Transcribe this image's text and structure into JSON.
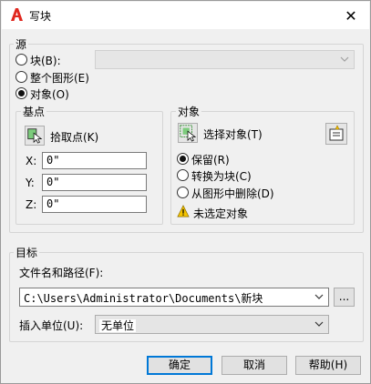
{
  "window": {
    "title": "写块",
    "close_glyph": "✕"
  },
  "source": {
    "legend": "源",
    "options": [
      {
        "label": "块(B):",
        "selected": false
      },
      {
        "label": "整个图形(E)",
        "selected": false
      },
      {
        "label": "对象(O)",
        "selected": true
      }
    ],
    "block_combo_value": ""
  },
  "basepoint": {
    "legend": "基点",
    "pick_label": "拾取点(K)",
    "x_label": "X:",
    "x_value": "0\"",
    "y_label": "Y:",
    "y_value": "0\"",
    "z_label": "Z:",
    "z_value": "0\""
  },
  "objects": {
    "legend": "对象",
    "select_label": "选择对象(T)",
    "options": [
      {
        "label": "保留(R)",
        "selected": true
      },
      {
        "label": "转换为块(C)",
        "selected": false
      },
      {
        "label": "从图形中删除(D)",
        "selected": false
      }
    ],
    "warning": "未选定对象"
  },
  "destination": {
    "legend": "目标",
    "path_label": "文件名和路径(F):",
    "path_value": "C:\\Users\\Administrator\\Documents\\新块",
    "browse_label": "...",
    "units_label": "插入单位(U):",
    "units_value": "无单位"
  },
  "buttons": {
    "ok": "确定",
    "cancel": "取消",
    "help": "帮助(H)"
  },
  "colors": {
    "accent": "#0078d7",
    "app_icon": "#e0281f",
    "warning": "#f5c400"
  }
}
